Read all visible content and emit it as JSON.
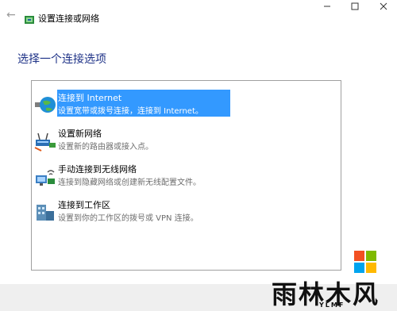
{
  "window": {
    "title": "设置连接或网络"
  },
  "main": {
    "heading": "选择一个连接选项"
  },
  "options": [
    {
      "title": "连接到 Internet",
      "desc": "设置宽带或拨号连接，连接到 Internet。"
    },
    {
      "title": "设置新网络",
      "desc": "设置新的路由器或接入点。"
    },
    {
      "title": "手动连接到无线网络",
      "desc": "连接到隐藏网络或创建新无线配置文件。"
    },
    {
      "title": "连接到工作区",
      "desc": "设置到你的工作区的拨号或 VPN 连接。"
    }
  ],
  "watermark": {
    "brand": "雨林木风",
    "sub": "YLMF"
  },
  "colors": {
    "accent": "#3399ff",
    "heading": "#1e3287",
    "logo_red": "#f25022",
    "logo_green": "#7fba00",
    "logo_blue": "#00a4ef",
    "logo_yellow": "#ffb900"
  }
}
